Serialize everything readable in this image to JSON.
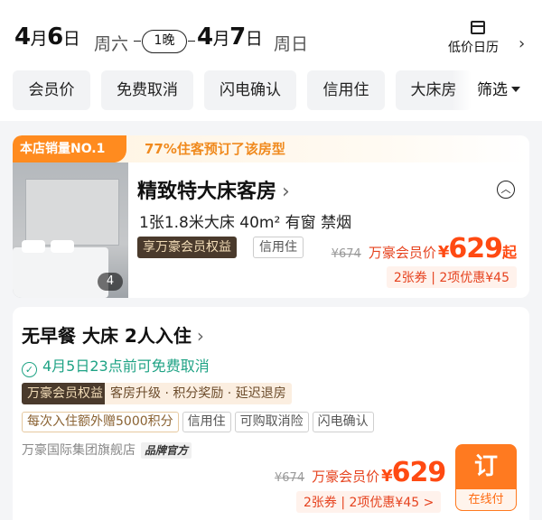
{
  "date_bar": {
    "checkin_month": "4",
    "checkin_day": "6",
    "checkin_weekday": "周六",
    "nights": "1晚",
    "checkout_month": "4",
    "checkout_day": "7",
    "checkout_weekday": "周日",
    "month_unit": "月",
    "day_unit": "日",
    "calendar_label": "低价日历"
  },
  "filters": {
    "chips": [
      "会员价",
      "免费取消",
      "闪电确认",
      "信用住",
      "大床房"
    ],
    "filter_label": "筛选"
  },
  "room": {
    "rank_badge": "本店销量NO.1",
    "promo_text": "77%住客预订了该房型",
    "name": "精致特大床客房",
    "specs": "1张1.8米大床  40m²  有窗  禁烟",
    "photo_count": "4",
    "member_tag": "享万豪会员权益",
    "credit_tag": "信用住",
    "original_price": "¥674",
    "member_price_label": "万豪会员价",
    "currency": "¥",
    "price": "629",
    "price_suffix": "起",
    "coupons": "2张券 | 2项优惠¥45"
  },
  "rate_plan": {
    "title": "无早餐 大床  2人入住",
    "cancel_policy": "4月5日23点前可免费取消",
    "benefit_label": "万豪会员权益",
    "benefit_items": "客房升级 · 积分奖励 · 延迟退房",
    "tags": [
      "每次入住额外赠5000积分",
      "信用住",
      "可购取消险",
      "闪电确认"
    ],
    "store_name": "万豪国际集团旗舰店",
    "official_badge": "品牌官方",
    "original_price": "¥674",
    "member_price_label": "万豪会员价",
    "currency": "¥",
    "price": "629",
    "coupons": "2张券 | 2项优惠¥45 >",
    "book_label": "订",
    "book_sub_label": "在线付"
  },
  "colors": {
    "accent_orange": "#ff7a20",
    "price_red": "#ff4a12",
    "cancel_green": "#1fa385",
    "member_dark": "#4a3a2c"
  }
}
